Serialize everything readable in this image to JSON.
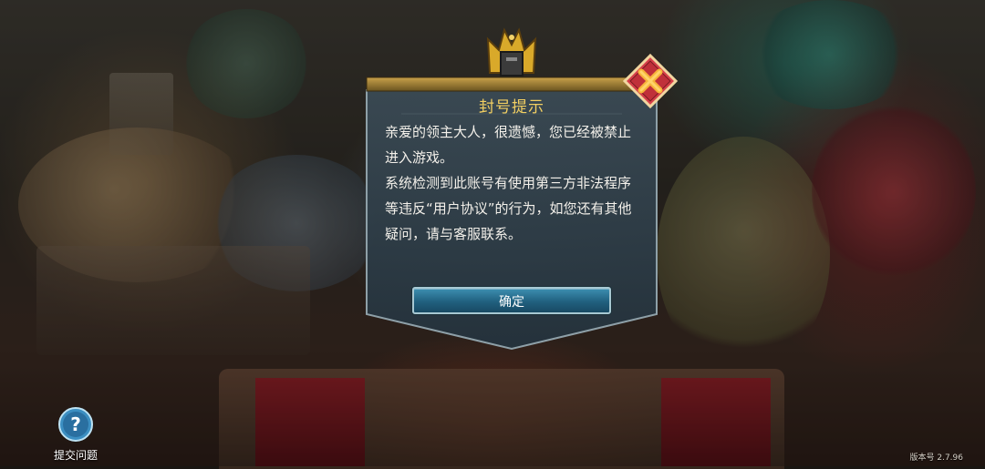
{
  "dialog": {
    "title": "封号提示",
    "message_lines": [
      "亲爱的领主大人，很遗憾，您已经被禁止进入游戏。",
      "系统检测到此账号有使用第三方非法程序等违反“用户协议”的行为，如您还有其他疑问，请与客服联系。"
    ],
    "confirm_label": "确定",
    "close_icon": "close-x-icon"
  },
  "help": {
    "label": "提交问题",
    "icon": "question-mark-icon"
  },
  "version_text": "版本号 2.7.96",
  "colors": {
    "title": "#f2cf62",
    "button": "#21607f",
    "close_badge": "#d7404a",
    "dialog_bg": "#2c3a44"
  }
}
